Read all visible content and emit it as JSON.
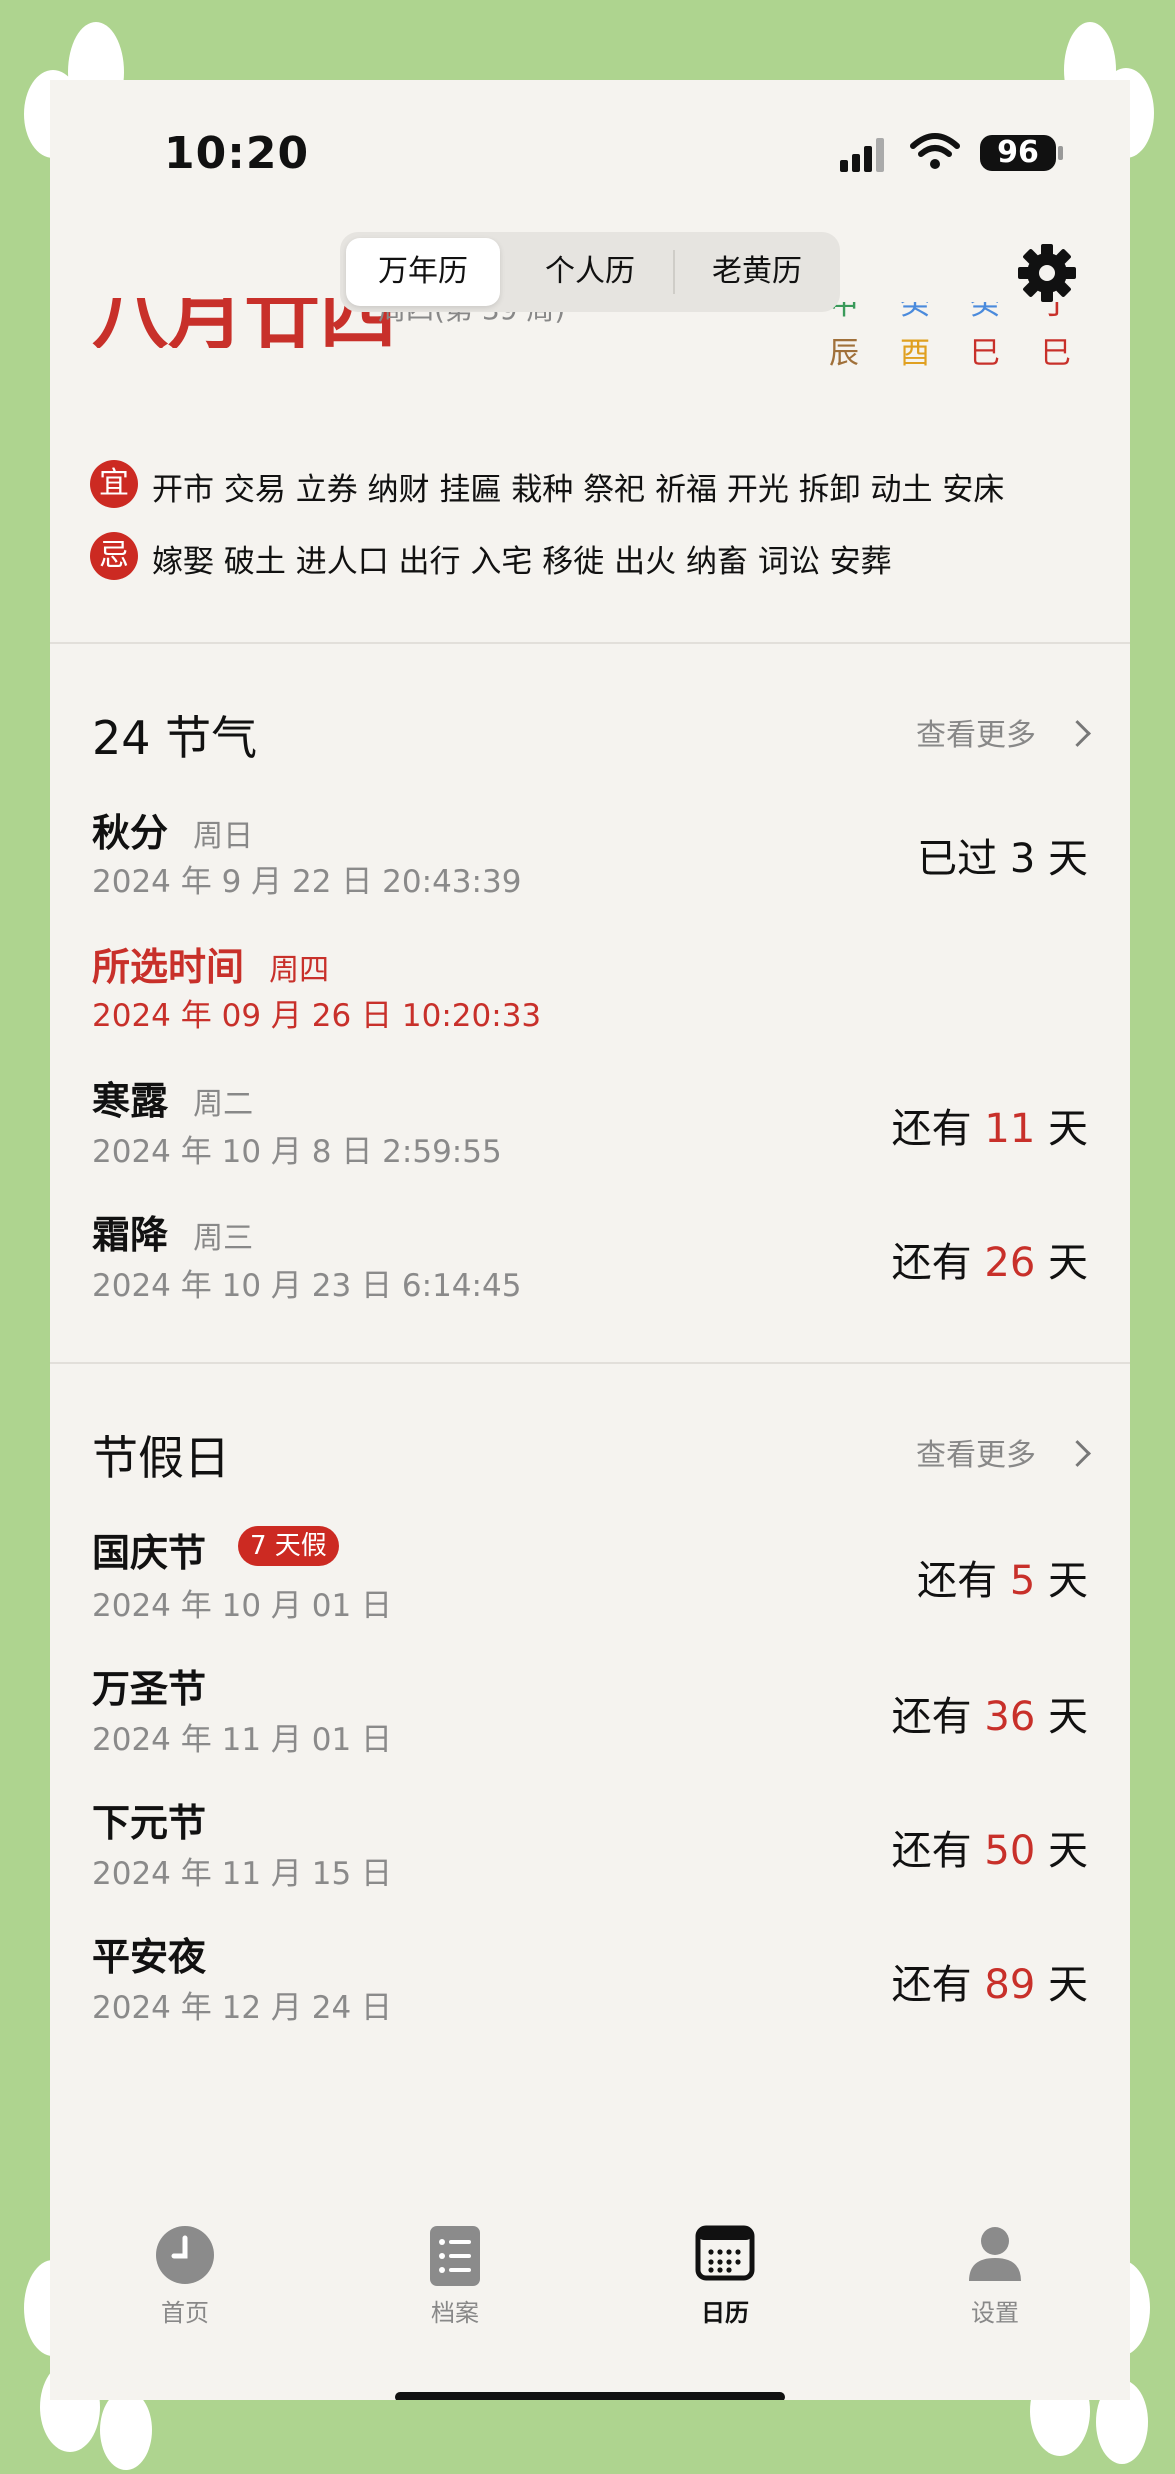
{
  "status_bar": {
    "time": "10:20",
    "battery": "96"
  },
  "segment": {
    "tabs": [
      "万年历",
      "个人历",
      "老黄历"
    ],
    "active_index": 0
  },
  "date_header": {
    "lunar_date": "八月廿四",
    "weekday_week": "周四(第 39 周)",
    "pillars": [
      {
        "top": "甲",
        "bottom": "辰",
        "top_color": "#3a9a5a",
        "bottom_color": "#a0703a"
      },
      {
        "top": "癸",
        "bottom": "酉",
        "top_color": "#4a8adc",
        "bottom_color": "#e0a020"
      },
      {
        "top": "癸",
        "bottom": "巳",
        "top_color": "#4a8adc",
        "bottom_color": "#c8302a"
      },
      {
        "top": "丁",
        "bottom": "巳",
        "top_color": "#c8302a",
        "bottom_color": "#c8302a"
      }
    ]
  },
  "yiji": {
    "yi_label": "宜",
    "yi_items": "开市 交易 立券 纳财 挂匾 栽种 祭祀 祈福 开光 拆卸 动土 安床",
    "ji_label": "忌",
    "ji_items": "嫁娶 破土 进人口 出行 入宅 移徙 出火 纳畜 词讼 安葬"
  },
  "solar_terms": {
    "title": "24 节气",
    "more": "查看更多",
    "items": [
      {
        "name": "秋分",
        "week": "周日",
        "date": "2024 年 9 月 22 日 20:43:39",
        "status": "已过 3 天"
      },
      {
        "name": "所选时间",
        "week": "周四",
        "date": "2024 年 09 月 26 日 10:20:33"
      },
      {
        "name": "寒露",
        "week": "周二",
        "date": "2024 年 10 月 8 日 2:59:55",
        "prefix": "还有",
        "days": "11",
        "suffix": "天"
      },
      {
        "name": "霜降",
        "week": "周三",
        "date": "2024 年 10 月 23 日 6:14:45",
        "prefix": "还有",
        "days": "26",
        "suffix": "天"
      }
    ]
  },
  "holidays": {
    "title": "节假日",
    "more": "查看更多",
    "items": [
      {
        "name": "国庆节",
        "tag": "7 天假",
        "date": "2024 年 10 月 01 日",
        "prefix": "还有",
        "days": "5",
        "suffix": "天"
      },
      {
        "name": "万圣节",
        "date": "2024 年 11 月 01 日",
        "prefix": "还有",
        "days": "36",
        "suffix": "天"
      },
      {
        "name": "下元节",
        "date": "2024 年 11 月 15 日",
        "prefix": "还有",
        "days": "50",
        "suffix": "天"
      },
      {
        "name": "平安夜",
        "date": "2024 年 12 月 24 日",
        "prefix": "还有",
        "days": "89",
        "suffix": "天"
      }
    ]
  },
  "tab_bar": [
    {
      "label": "首页",
      "icon": "clock-icon"
    },
    {
      "label": "档案",
      "icon": "list-icon"
    },
    {
      "label": "日历",
      "icon": "calendar-icon",
      "active": true
    },
    {
      "label": "设置",
      "icon": "person-icon"
    }
  ]
}
